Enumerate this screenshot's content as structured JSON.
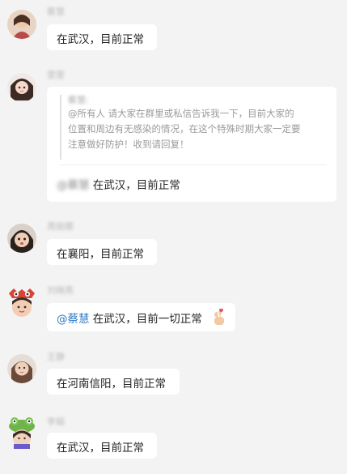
{
  "messages": [
    {
      "sender": "蔡慧",
      "text": "在武汉，目前正常"
    },
    {
      "sender": "雯雯",
      "quote": {
        "author": "蔡慧:",
        "lines": [
          "@所有人 请大家在群里或私信告诉我一下，目前大家的",
          "位置和周边有无感染的情况，在这个特殊时期大家一定要",
          "注意做好防护！收到请回复！"
        ]
      },
      "mention": "@蔡慧",
      "text": "在武汉，目前正常"
    },
    {
      "sender": "周丽娜",
      "text": "在襄阳，目前正常"
    },
    {
      "sender": "刘晓燕",
      "mention": "@蔡慧",
      "text": "在武汉，目前一切正常",
      "emoji": "🫰"
    },
    {
      "sender": "王静",
      "text": "在河南信阳，目前正常"
    },
    {
      "sender": "李娟",
      "text": "在武汉，目前正常"
    }
  ],
  "colors": {
    "background": "#f3f3f3",
    "bubble": "#ffffff",
    "mention": "#2f78c4",
    "quote_text": "#9a9a9a"
  }
}
